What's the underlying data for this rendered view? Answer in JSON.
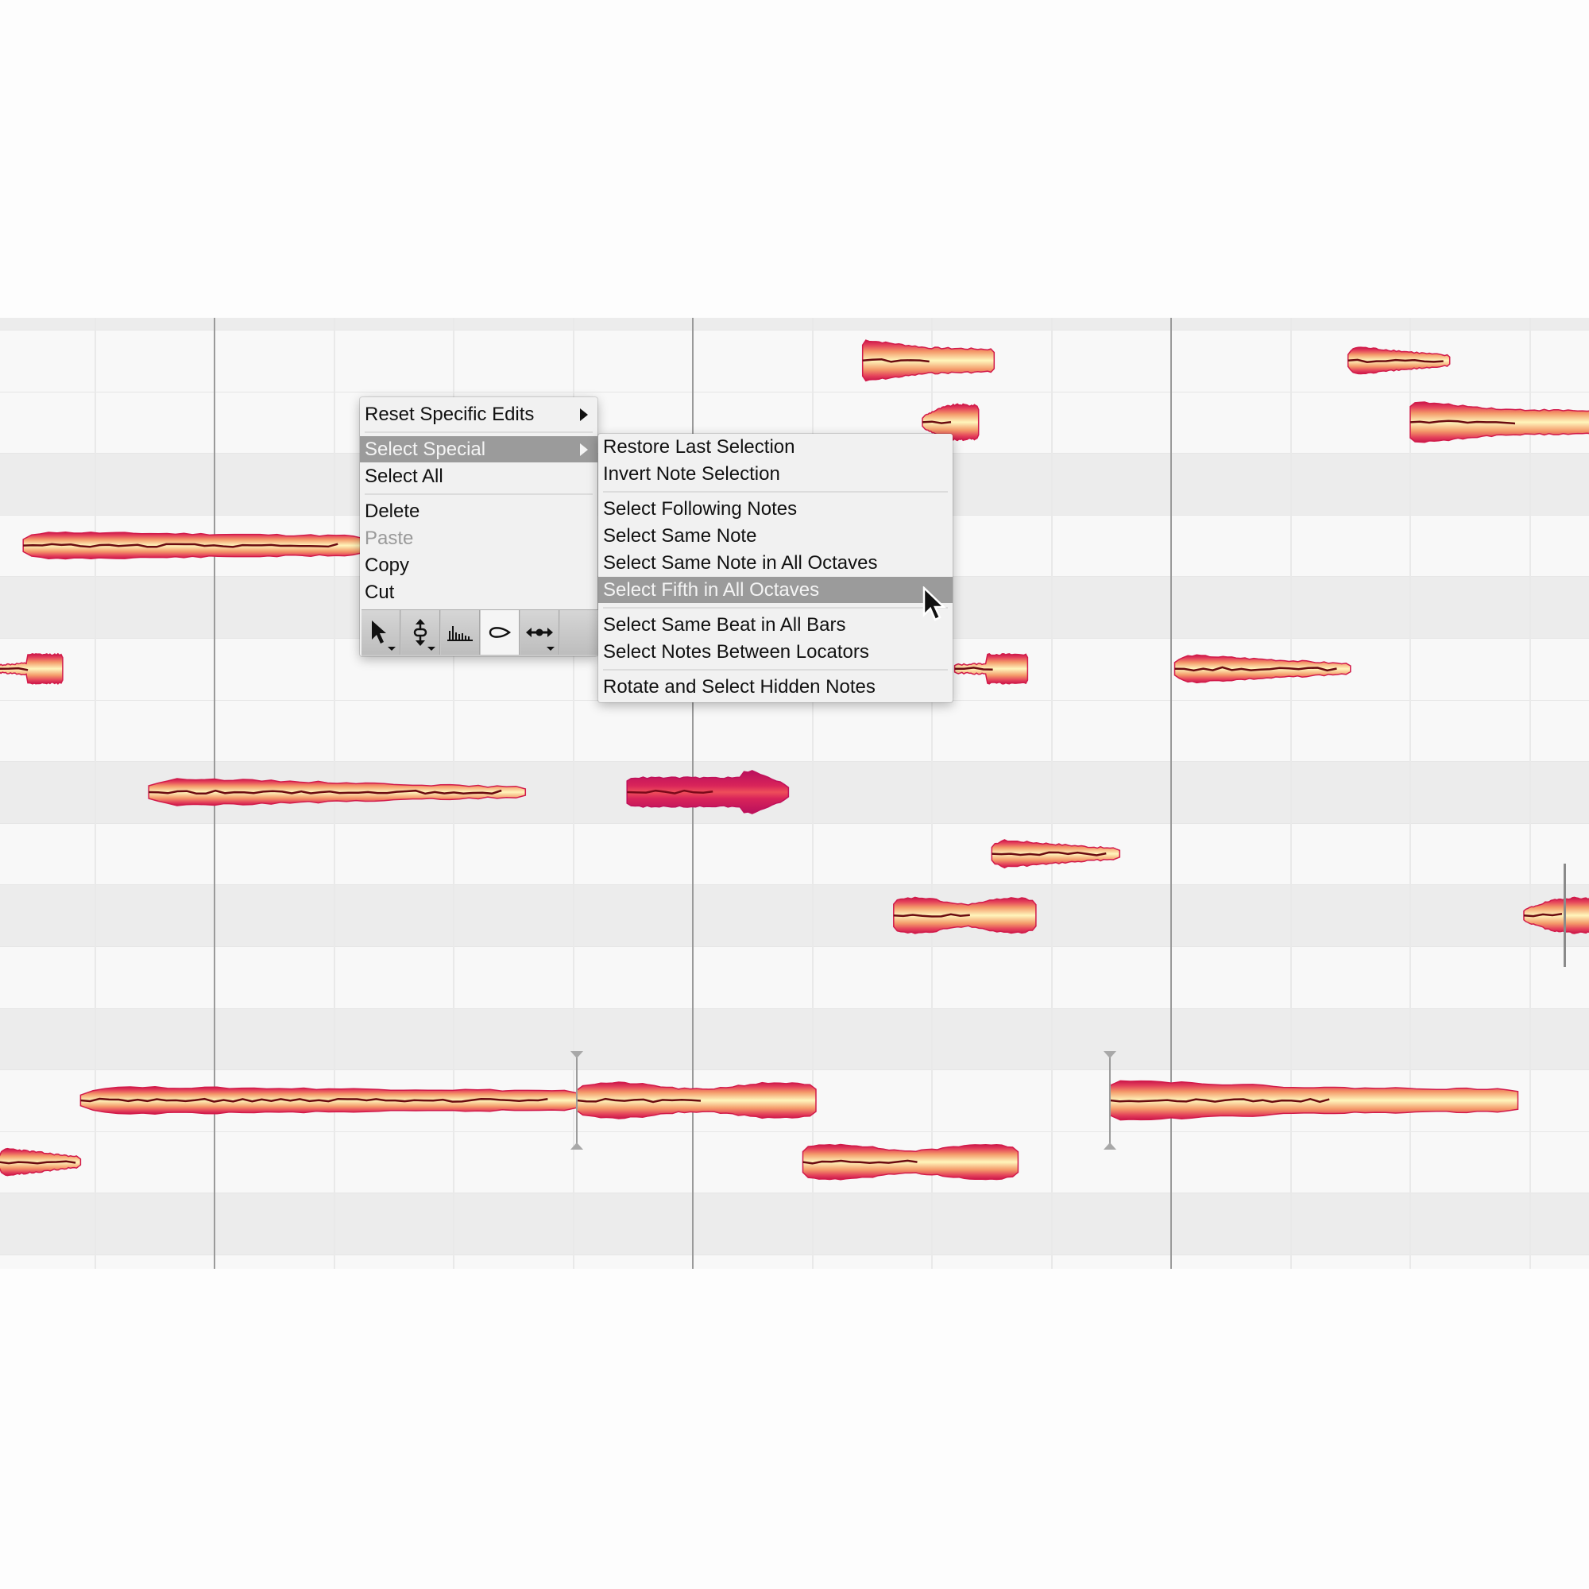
{
  "context_menu": {
    "items": [
      {
        "label": "Reset Specific Edits",
        "submenu": true,
        "state": "normal"
      },
      {
        "separator": true
      },
      {
        "label": "Select Special",
        "submenu": true,
        "state": "highlighted"
      },
      {
        "label": "Select All",
        "state": "normal"
      },
      {
        "separator": true
      },
      {
        "label": "Delete",
        "state": "normal"
      },
      {
        "label": "Paste",
        "state": "disabled"
      },
      {
        "label": "Copy",
        "state": "normal"
      },
      {
        "label": "Cut",
        "state": "normal"
      }
    ],
    "toolbar": [
      {
        "icon": "main-tool-arrow-icon",
        "has_dropdown": true,
        "active": false
      },
      {
        "icon": "pitch-tool-icon",
        "has_dropdown": true,
        "active": false
      },
      {
        "icon": "amplitude-tool-icon",
        "has_dropdown": false,
        "active": false
      },
      {
        "icon": "formant-tool-icon",
        "has_dropdown": false,
        "active": true
      },
      {
        "icon": "time-tool-icon",
        "has_dropdown": true,
        "active": false
      }
    ]
  },
  "select_special_submenu": {
    "items": [
      {
        "label": "Restore Last Selection",
        "state": "normal"
      },
      {
        "label": "Invert Note Selection",
        "state": "normal"
      },
      {
        "separator": true
      },
      {
        "label": "Select Following Notes",
        "state": "normal"
      },
      {
        "label": "Select Same Note",
        "state": "normal"
      },
      {
        "label": "Select Same Note in All Octaves",
        "state": "normal"
      },
      {
        "label": "Select Fifth in All Octaves",
        "state": "highlighted"
      },
      {
        "separator": true
      },
      {
        "label": "Select Same Beat in All Bars",
        "state": "normal"
      },
      {
        "label": "Select Notes Between Locators",
        "state": "normal"
      },
      {
        "separator": true
      },
      {
        "label": "Rotate and Select Hidden Notes",
        "state": "normal"
      }
    ]
  },
  "note_editor": {
    "lanes": [
      "light",
      "light",
      "dark",
      "light",
      "dark",
      "light",
      "light",
      "dark",
      "light",
      "dark",
      "light",
      "dark",
      "light",
      "light",
      "dark"
    ],
    "bar_lines_beats": [
      0,
      4,
      8
    ],
    "beats_per_bar": 4,
    "visible_beats": [
      -1.8,
      11.5
    ],
    "notes": [
      {
        "lane": 0,
        "start": 5.42,
        "end": 6.52,
        "shape": "fat-start",
        "selected": false
      },
      {
        "lane": 0,
        "start": 9.48,
        "end": 10.33,
        "shape": "taper",
        "selected": false
      },
      {
        "lane": 1,
        "start": 5.92,
        "end": 6.39,
        "shape": "round",
        "selected": false
      },
      {
        "lane": 1,
        "start": 10.0,
        "end": 11.6,
        "shape": "fat-start",
        "selected": false
      },
      {
        "lane": 3,
        "start": -1.6,
        "end": 1.23,
        "shape": "long",
        "selected": false
      },
      {
        "lane": 5,
        "start": -1.8,
        "end": -1.27,
        "shape": "thin-start",
        "selected": false
      },
      {
        "lane": 5,
        "start": 6.19,
        "end": 6.8,
        "shape": "thin-start",
        "selected": false
      },
      {
        "lane": 5,
        "start": 8.03,
        "end": 9.5,
        "shape": "taper",
        "selected": false
      },
      {
        "lane": 7,
        "start": -0.55,
        "end": 2.6,
        "shape": "taper",
        "selected": false
      },
      {
        "lane": 7,
        "start": 3.45,
        "end": 4.8,
        "shape": "arrow",
        "selected": true
      },
      {
        "lane": 8,
        "start": 6.5,
        "end": 7.57,
        "shape": "taper",
        "selected": false
      },
      {
        "lane": 9,
        "start": 5.68,
        "end": 6.87,
        "shape": "bulge",
        "selected": false
      },
      {
        "lane": 9,
        "start": 10.95,
        "end": 11.6,
        "shape": "round",
        "selected": false
      },
      {
        "lane": 12,
        "start": -1.12,
        "end": 3.03,
        "shape": "long",
        "selected": false
      },
      {
        "lane": 12,
        "start": 3.03,
        "end": 5.03,
        "shape": "bulge",
        "selected": false
      },
      {
        "lane": 12,
        "start": 7.49,
        "end": 10.9,
        "shape": "fat-start",
        "selected": false
      },
      {
        "lane": 13,
        "start": -1.8,
        "end": -1.12,
        "shape": "taper",
        "selected": false
      },
      {
        "lane": 13,
        "start": 4.92,
        "end": 6.72,
        "shape": "bulge",
        "selected": false
      }
    ],
    "separators": [
      {
        "beat": 3.03,
        "lane": 12
      },
      {
        "beat": 7.49,
        "lane": 12
      }
    ],
    "playhead_like": {
      "beat": 11.28,
      "lane": 9
    },
    "colors": {
      "note_edge": "#d21a4a",
      "note_mid": "#f29a6a",
      "note_core": "#fff4b8",
      "pitch_line": "#6a0a10",
      "selected_edge": "#c0105a",
      "selected_core": "#ea4a62"
    }
  }
}
